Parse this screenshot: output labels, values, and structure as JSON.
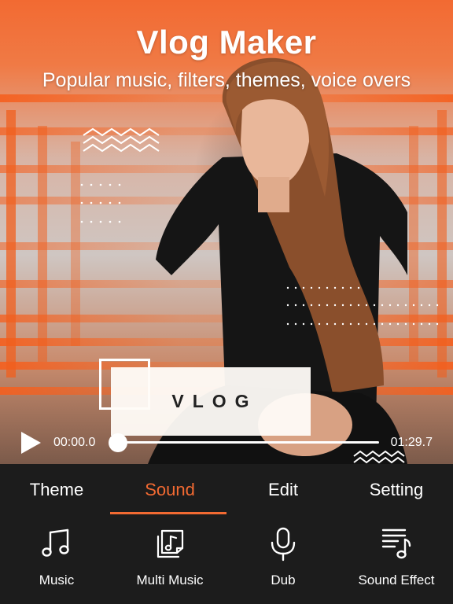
{
  "header": {
    "title": "Vlog Maker",
    "subtitle": "Popular music, filters, themes, voice overs"
  },
  "overlay": {
    "vlog_text": "VLOG"
  },
  "player": {
    "time_start": "00:00.0",
    "time_end": "01:29.7",
    "progress": 0
  },
  "tabs": [
    {
      "label": "Theme",
      "active": false
    },
    {
      "label": "Sound",
      "active": true
    },
    {
      "label": "Edit",
      "active": false
    },
    {
      "label": "Setting",
      "active": false
    }
  ],
  "tools": [
    {
      "label": "Music",
      "icon": "music-note-icon"
    },
    {
      "label": "Multi Music",
      "icon": "multi-music-icon"
    },
    {
      "label": "Dub",
      "icon": "microphone-icon"
    },
    {
      "label": "Sound Effect",
      "icon": "sound-effect-icon"
    }
  ],
  "colors": {
    "accent": "#f26a32",
    "panel_bg": "#1c1c1c",
    "text": "#ffffff"
  }
}
